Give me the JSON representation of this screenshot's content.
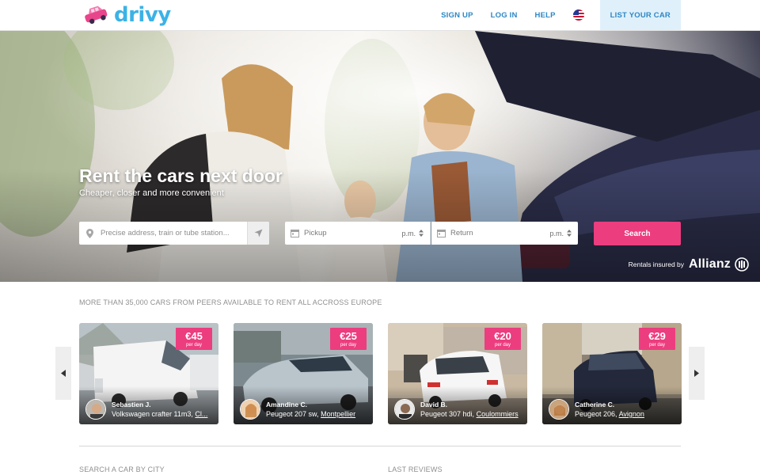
{
  "brand": {
    "name": "drivy",
    "logo_icon": "pink-car-logo",
    "brand_color": "#3cb2e6",
    "accent_color": "#ec3d7f"
  },
  "nav": {
    "sign_up": "SIGN UP",
    "log_in": "LOG IN",
    "help": "HELP",
    "language_icon": "us-flag-icon",
    "list_car": "LIST YOUR CAR"
  },
  "hero": {
    "title": "Rent the cars next door",
    "subtitle": "Cheaper, closer and more convenient",
    "search": {
      "address_placeholder": "Precise address, train or tube station...",
      "pickup_label": "Pickup",
      "pickup_time": "p.m.",
      "return_label": "Return",
      "return_time": "p.m.",
      "button": "Search"
    },
    "insurance": {
      "text": "Rentals insured by",
      "insurer": "Allianz"
    }
  },
  "cars_section": {
    "heading": "MORE THAN 35,000 CARS FROM PEERS AVAILABLE TO RENT ALL ACCROSS EUROPE",
    "cards": [
      {
        "price": "€45",
        "per": "per day",
        "owner": "Sebastien J.",
        "model": "Volkswagen crafter 11m3,",
        "city": "Cl..."
      },
      {
        "price": "€25",
        "per": "per day",
        "owner": "Amandine C.",
        "model": "Peugeot 207 sw,",
        "city": "Montpellier"
      },
      {
        "price": "€20",
        "per": "per day",
        "owner": "David B.",
        "model": "Peugeot 307 hdi,",
        "city": "Coulommiers"
      },
      {
        "price": "€29",
        "per": "per day",
        "owner": "Catherine C.",
        "model": "Peugeot 206,",
        "city": "Avignon"
      }
    ]
  },
  "footer": {
    "search_by_city": "SEARCH A CAR BY CITY",
    "last_reviews": "LAST REVIEWS"
  }
}
